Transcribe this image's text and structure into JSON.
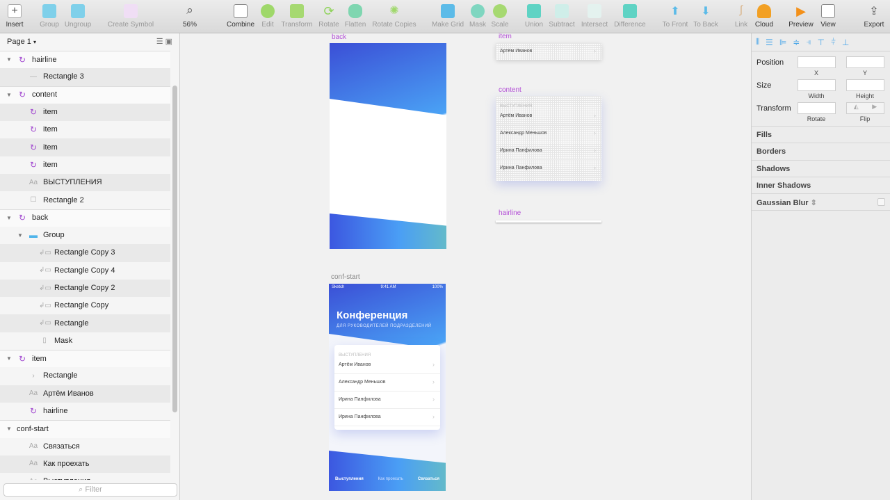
{
  "toolbar": {
    "insert": "Insert",
    "group": "Group",
    "ungroup": "Ungroup",
    "create_symbol": "Create Symbol",
    "zoom": "56%",
    "zoom_minus": "–",
    "zoom_plus": "+",
    "combine": "Combine",
    "edit": "Edit",
    "transform": "Transform",
    "rotate": "Rotate",
    "flatten": "Flatten",
    "rotate_copies": "Rotate Copies",
    "make_grid": "Make Grid",
    "mask": "Mask",
    "scale": "Scale",
    "union": "Union",
    "subtract": "Subtract",
    "intersect": "Intersect",
    "difference": "Difference",
    "to_front": "To Front",
    "to_back": "To Back",
    "link": "Link",
    "cloud": "Cloud",
    "preview": "Preview",
    "view": "View",
    "export": "Export"
  },
  "layers_panel": {
    "page": "Page 1",
    "filter_placeholder": "Filter",
    "layers": [
      {
        "name": "hairline",
        "type": "symbol",
        "level": 0,
        "expanded": true
      },
      {
        "name": "Rectangle 3",
        "type": "line",
        "level": 1
      },
      {
        "name": "content",
        "type": "symbol",
        "level": 0,
        "expanded": true
      },
      {
        "name": "item",
        "type": "symbol",
        "level": 1
      },
      {
        "name": "item",
        "type": "symbol",
        "level": 1
      },
      {
        "name": "item",
        "type": "symbol",
        "level": 1
      },
      {
        "name": "item",
        "type": "symbol",
        "level": 1
      },
      {
        "name": "ВЫСТУПЛЕНИЯ",
        "type": "text",
        "level": 1
      },
      {
        "name": "Rectangle 2",
        "type": "rect",
        "level": 1
      },
      {
        "name": "back",
        "type": "symbol",
        "level": 0,
        "expanded": true
      },
      {
        "name": "Group",
        "type": "folder",
        "level": 1,
        "expanded": true
      },
      {
        "name": "Rectangle Copy 3",
        "type": "masked",
        "level": 2
      },
      {
        "name": "Rectangle Copy 4",
        "type": "masked",
        "level": 2
      },
      {
        "name": "Rectangle Copy 2",
        "type": "masked",
        "level": 2
      },
      {
        "name": "Rectangle Copy",
        "type": "masked",
        "level": 2
      },
      {
        "name": "Rectangle",
        "type": "masked",
        "level": 2
      },
      {
        "name": "Mask",
        "type": "mask",
        "level": 2
      },
      {
        "name": "item",
        "type": "symbol",
        "level": 0,
        "expanded": true
      },
      {
        "name": "Rectangle",
        "type": "chevron",
        "level": 1
      },
      {
        "name": "Артём Иванов",
        "type": "text",
        "level": 1
      },
      {
        "name": "hairline",
        "type": "symbol",
        "level": 1
      },
      {
        "name": "conf-start",
        "type": "artboard",
        "level": 0,
        "expanded": true
      },
      {
        "name": "Связаться",
        "type": "text",
        "level": 1
      },
      {
        "name": "Как проехать",
        "type": "text",
        "level": 1
      },
      {
        "name": "Выступления",
        "type": "text",
        "level": 1
      }
    ]
  },
  "inspector": {
    "position": "Position",
    "x": "X",
    "y": "Y",
    "size": "Size",
    "width": "Width",
    "height": "Height",
    "transform": "Transform",
    "rotate": "Rotate",
    "flip": "Flip",
    "sections": [
      "Fills",
      "Borders",
      "Shadows",
      "Inner Shadows",
      "Gaussian Blur"
    ]
  },
  "canvas": {
    "back_label": "back",
    "item_label": "item",
    "content_label": "content",
    "hairline_label": "hairline",
    "conf_label": "conf-start",
    "item_text": "Артём Иванов",
    "section_title": "ВЫСТУПЛЕНИЯ",
    "speakers": [
      "Артём Иванов",
      "Александр Меньшов",
      "Ирина Панфилова",
      "Ирина Панфилова"
    ],
    "status": {
      "carrier": "Sketch",
      "time": "9:41 AM",
      "battery": "100%"
    },
    "conf_title": "Конференция",
    "conf_subtitle": "ДЛЯ РУКОВОДИТЕЛЕЙ ПОДРАЗДЕЛЕНИЙ",
    "tabs": [
      "Выступления",
      "Как проехать",
      "Связаться"
    ]
  }
}
